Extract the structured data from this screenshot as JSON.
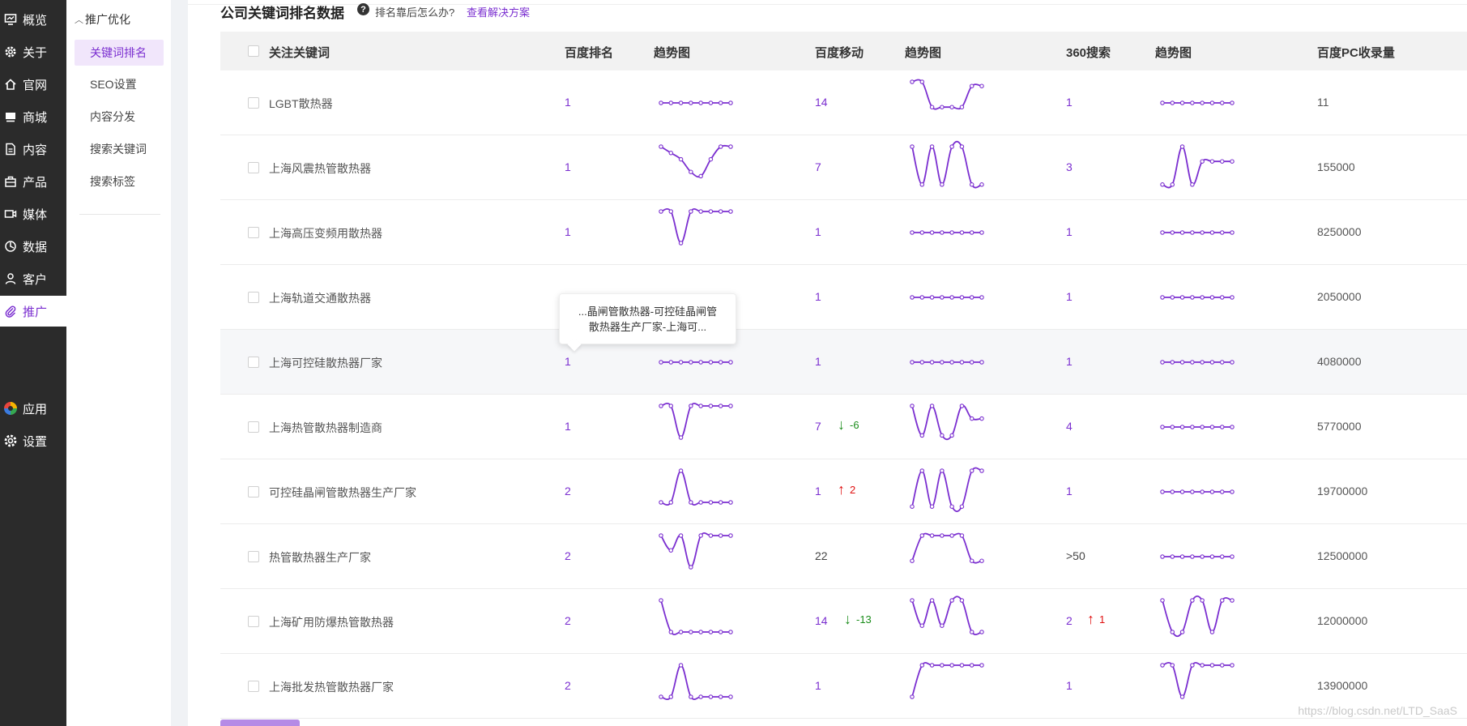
{
  "rail": {
    "items": [
      {
        "label": "概览",
        "icon": "dashboard-icon"
      },
      {
        "label": "关于",
        "icon": "gear-icon"
      },
      {
        "label": "官网",
        "icon": "home-icon"
      },
      {
        "label": "商城",
        "icon": "shop-icon"
      },
      {
        "label": "内容",
        "icon": "document-icon"
      },
      {
        "label": "产品",
        "icon": "box-icon"
      },
      {
        "label": "媒体",
        "icon": "video-icon"
      },
      {
        "label": "数据",
        "icon": "pie-chart-icon"
      },
      {
        "label": "客户",
        "icon": "user-icon"
      },
      {
        "label": "推广",
        "icon": "paperclip-icon"
      },
      {
        "label": "应用",
        "icon": "apps-icon"
      },
      {
        "label": "设置",
        "icon": "settings-icon"
      }
    ],
    "active": "推广"
  },
  "subnav": {
    "group_label": "推广优化",
    "items": [
      "关键词排名",
      "SEO设置",
      "内容分发",
      "搜索关键词",
      "搜索标签"
    ],
    "active": "关键词排名"
  },
  "header": {
    "title": "公司关键词排名数据",
    "help_icon": "question-circle-icon",
    "subtitle": "排名靠后怎么办?",
    "link": "查看解决方案"
  },
  "table": {
    "columns": [
      "关注关键词",
      "百度排名",
      "趋势图",
      "百度移动",
      "趋势图",
      "360搜索",
      "趋势图",
      "百度PC收录量"
    ],
    "rows": [
      {
        "keyword": "LGBT散热器",
        "baidu": "1",
        "mobile": "14",
        "mobile_delta": "",
        "s360": "1",
        "s360_delta": "",
        "pc": "11"
      },
      {
        "keyword": "上海风震热管散热器",
        "baidu": "1",
        "mobile": "7",
        "mobile_delta": "",
        "s360": "3",
        "s360_delta": "",
        "pc": "155000"
      },
      {
        "keyword": "上海高压变频用散热器",
        "baidu": "1",
        "mobile": "1",
        "mobile_delta": "",
        "s360": "1",
        "s360_delta": "",
        "pc": "8250000"
      },
      {
        "keyword": "上海轨道交通散热器",
        "baidu": "",
        "mobile": "1",
        "mobile_delta": "",
        "s360": "1",
        "s360_delta": "",
        "pc": "2050000"
      },
      {
        "keyword": "上海可控硅散热器厂家",
        "baidu": "1",
        "mobile": "1",
        "mobile_delta": "",
        "s360": "1",
        "s360_delta": "",
        "pc": "4080000"
      },
      {
        "keyword": "上海热管散热器制造商",
        "baidu": "1",
        "mobile": "7",
        "mobile_delta": "-6",
        "s360": "4",
        "s360_delta": "",
        "pc": "5770000"
      },
      {
        "keyword": "可控硅晶闸管散热器生产厂家",
        "baidu": "2",
        "mobile": "1",
        "mobile_delta": "2",
        "s360": "1",
        "s360_delta": "",
        "pc": "19700000"
      },
      {
        "keyword": "热管散热器生产厂家",
        "baidu": "2",
        "mobile": "22",
        "mobile_delta": "",
        "s360": ">50",
        "s360_delta": "",
        "pc": "12500000"
      },
      {
        "keyword": "上海矿用防爆热管散热器",
        "baidu": "2",
        "mobile": "14",
        "mobile_delta": "-13",
        "s360": "2",
        "s360_delta": "1",
        "pc": "12000000"
      },
      {
        "keyword": "上海批发热管散热器厂家",
        "baidu": "2",
        "mobile": "1",
        "mobile_delta": "",
        "s360": "1",
        "s360_delta": "",
        "pc": "13900000"
      }
    ]
  },
  "tooltip": {
    "line1": "...晶闸管散热器-可控硅晶闸管",
    "line2": "散热器生产厂家-上海可..."
  },
  "watermark": "https://blog.csdn.net/LTD_SaaS",
  "colors": {
    "accent": "#7b2fd0",
    "rail_bg": "#2b2b2b",
    "up": "#e01010",
    "down": "#1a8c1a"
  }
}
